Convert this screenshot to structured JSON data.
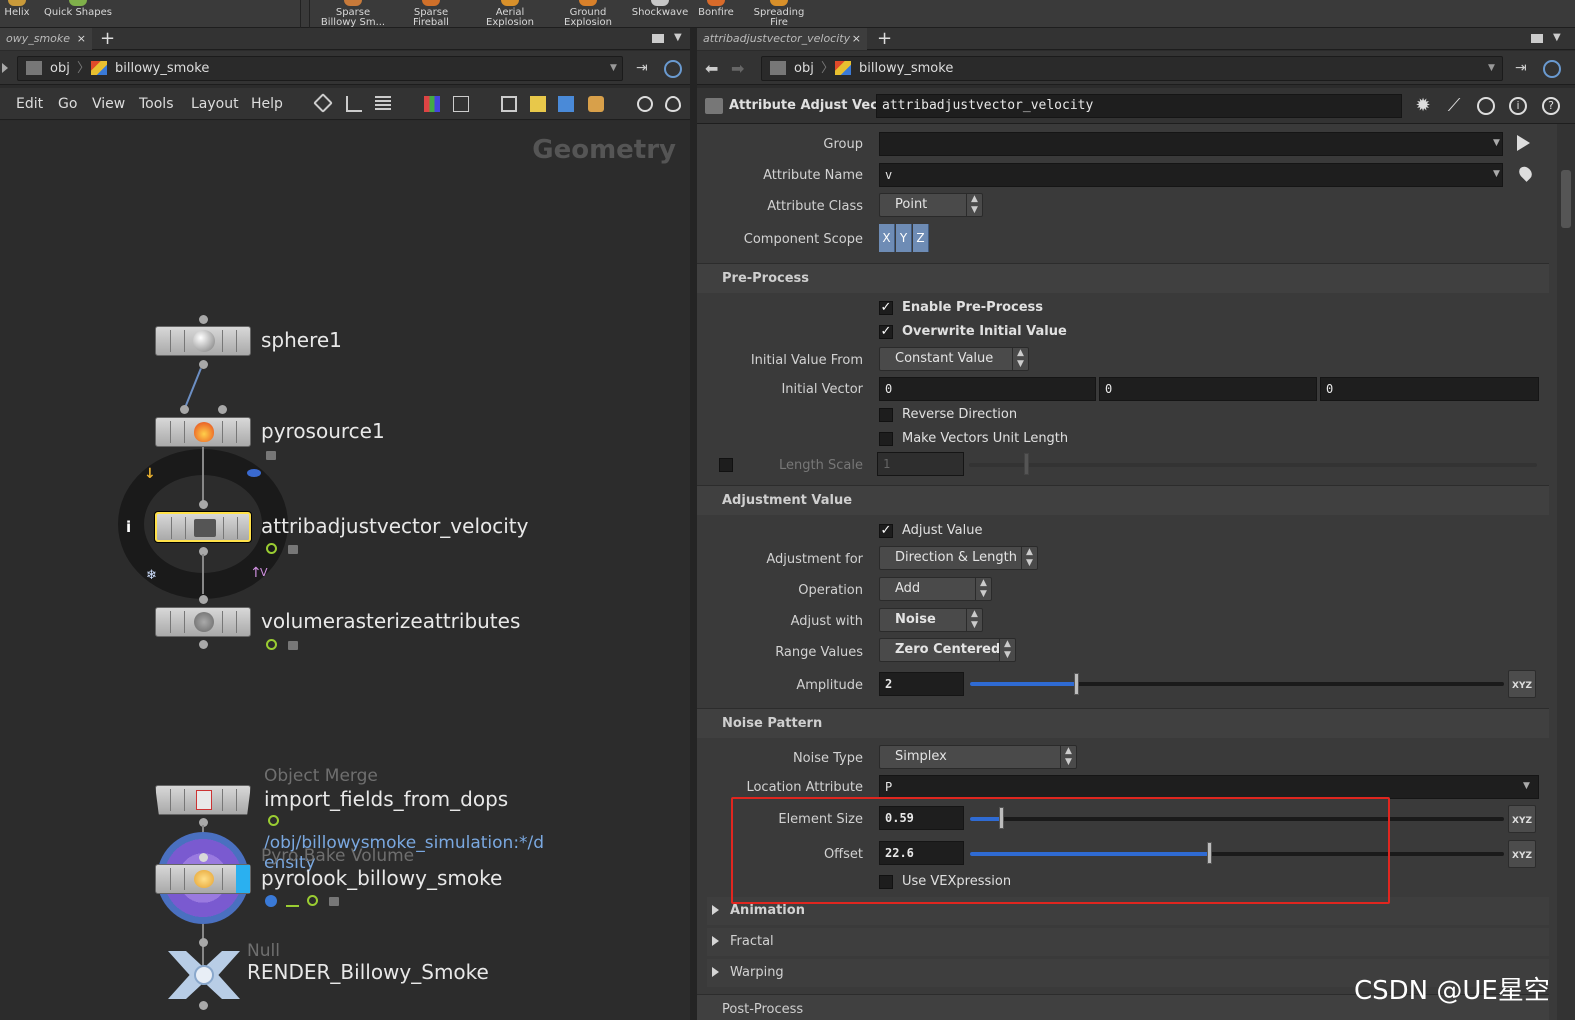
{
  "shelf": {
    "tools": [
      {
        "label": "Helix",
        "color": "#c99a3a"
      },
      {
        "label": "Quick Shapes",
        "color": "#7fb04a"
      },
      {
        "label": "Sparse Billowy Sm...",
        "color": "#c87a3a"
      },
      {
        "label": "Sparse Fireball",
        "color": "#d0702a"
      },
      {
        "label": "Aerial Explosion",
        "color": "#d8902a"
      },
      {
        "label": "Ground Explosion",
        "color": "#d8802a"
      },
      {
        "label": "Shockwave",
        "color": "#c8c8c8"
      },
      {
        "label": "Bonfire",
        "color": "#d86a2a"
      },
      {
        "label": "Spreading Fire",
        "color": "#d8902a"
      }
    ]
  },
  "left_pane": {
    "tab_label": "owy_smoke",
    "tab_close": "×",
    "tab_add": "+",
    "path": {
      "root": "obj",
      "node": "billowy_smoke"
    },
    "menu": [
      "Edit",
      "Go",
      "View",
      "Tools",
      "Layout",
      "Help"
    ],
    "network_title": "Geometry",
    "nodes": {
      "sphere": {
        "name": "sphere1"
      },
      "pyrosource": {
        "name": "pyrosource1"
      },
      "attribadjust": {
        "name": "attribadjustvector_velocity",
        "ring_info": "i",
        "ring_v": "V"
      },
      "volraster": {
        "name": "volumerasterizeattributes"
      },
      "objmerge": {
        "type": "Object Merge",
        "name": "import_fields_from_dops",
        "comment": "/obj/billowysmoke_simulation:*/d ensity"
      },
      "pyrobake": {
        "type": "Pyro Bake Volume",
        "name": "pyrolook_billowy_smoke"
      },
      "nullnode": {
        "type": "Null",
        "name": "RENDER_Billowy_Smoke"
      }
    }
  },
  "right_pane": {
    "tab_label": "attribadjustvector_velocity",
    "tab_close": "×",
    "tab_add": "+",
    "path": {
      "root": "obj",
      "node": "billowy_smoke"
    },
    "header": {
      "node_type": "Attribute Adjust Vector",
      "node_name": "attribadjustvector_velocity"
    },
    "params": {
      "group": {
        "label": "Group",
        "value": ""
      },
      "attribute_name": {
        "label": "Attribute Name",
        "value": "v"
      },
      "attribute_class": {
        "label": "Attribute Class",
        "value": "Point"
      },
      "component_scope": {
        "label": "Component Scope",
        "x": "X",
        "y": "Y",
        "z": "Z"
      },
      "preprocess": {
        "title": "Pre-Process",
        "enable": {
          "label": "Enable Pre-Process",
          "checked": true
        },
        "overwrite": {
          "label": "Overwrite Initial Value",
          "checked": true
        },
        "initial_value_from": {
          "label": "Initial Value From",
          "value": "Constant Value"
        },
        "initial_vector": {
          "label": "Initial Vector",
          "x": "0",
          "y": "0",
          "z": "0"
        },
        "reverse": {
          "label": "Reverse Direction",
          "checked": false
        },
        "unit_length": {
          "label": "Make Vectors Unit Length",
          "checked": false
        },
        "length_scale": {
          "label": "Length Scale",
          "value": "1"
        }
      },
      "adjustment": {
        "title": "Adjustment Value",
        "adjust_value": {
          "label": "Adjust Value",
          "checked": true
        },
        "adjustment_for": {
          "label": "Adjustment for",
          "value": "Direction & Length"
        },
        "operation": {
          "label": "Operation",
          "value": "Add"
        },
        "adjust_with": {
          "label": "Adjust with",
          "value": "Noise"
        },
        "range_values": {
          "label": "Range Values",
          "value": "Zero Centered"
        },
        "amplitude": {
          "label": "Amplitude",
          "value": "2",
          "slider": 0.2
        }
      },
      "noise": {
        "title": "Noise Pattern",
        "noise_type": {
          "label": "Noise Type",
          "value": "Simplex"
        },
        "location_attribute": {
          "label": "Location Attribute",
          "value": "P"
        },
        "element_size": {
          "label": "Element Size",
          "value": "0.59",
          "slider": 0.059
        },
        "offset": {
          "label": "Offset",
          "value": "22.6",
          "slider": 0.45
        },
        "use_vex": {
          "label": "Use VEXpression",
          "checked": false
        }
      },
      "folders": {
        "animation": "Animation",
        "fractal": "Fractal",
        "warping": "Warping"
      },
      "postprocess": {
        "title": "Post-Process"
      },
      "xyz_label": "XYZ"
    }
  },
  "colors": {
    "accent_blue": "#2f6bd3",
    "highlight_red": "#e0261f",
    "selected_node": "#ffe14a"
  },
  "watermark": "CSDN @UE星空"
}
